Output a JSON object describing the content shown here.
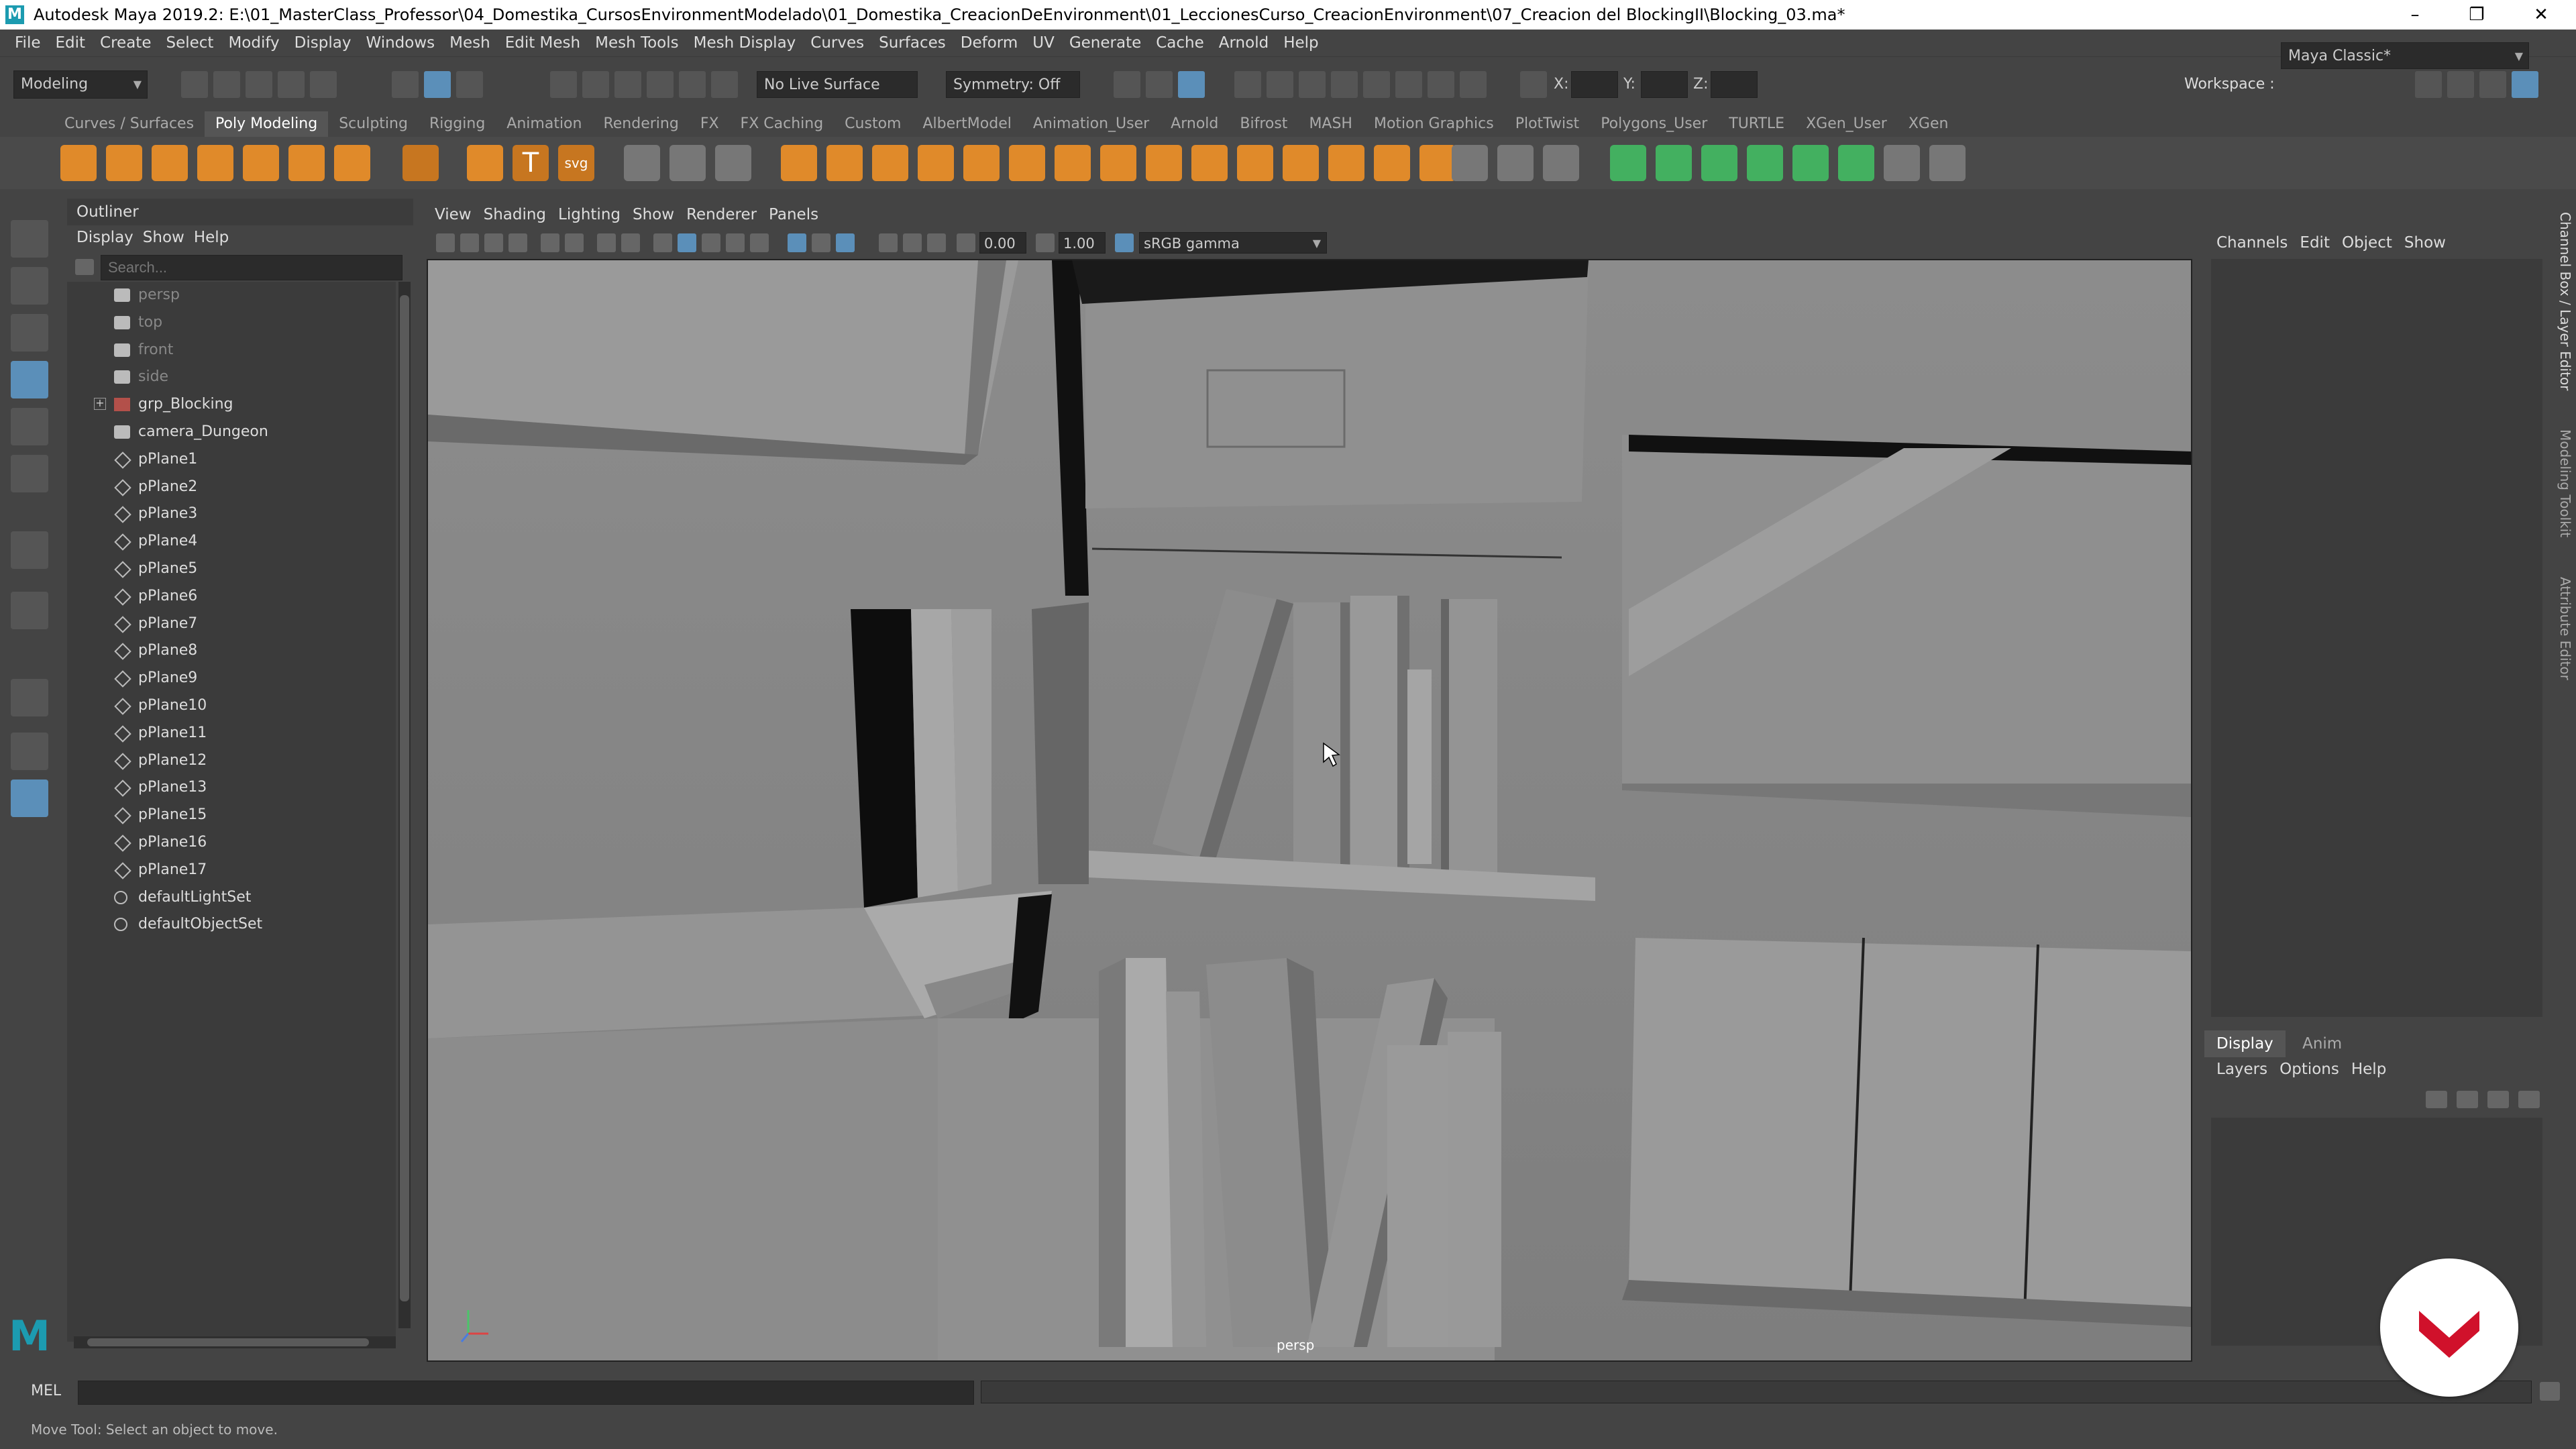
{
  "window": {
    "title": "Autodesk Maya 2019.2: E:\\01_MasterClass_Professor\\04_Domestika_CursosEnvironmentModelado\\01_Domestika_CreacionDeEnvironment\\01_LeccionesCurso_CreacionEnvironment\\07_Creacion del BlockingII\\Blocking_03.ma*",
    "logo": "M",
    "minimize": "–",
    "restore": "❐",
    "close": "✕"
  },
  "menubar": [
    "File",
    "Edit",
    "Create",
    "Select",
    "Modify",
    "Display",
    "Windows",
    "Mesh",
    "Edit Mesh",
    "Mesh Tools",
    "Mesh Display",
    "Curves",
    "Surfaces",
    "Deform",
    "UV",
    "Generate",
    "Cache",
    "Arnold",
    "Help"
  ],
  "statusline": {
    "menuset": "Modeling",
    "live_surface": "No Live Surface",
    "symmetry": "Symmetry: Off",
    "x_label": "X:",
    "y_label": "Y:",
    "z_label": "Z:",
    "workspace_label": "Workspace :",
    "workspace_value": "Maya Classic*"
  },
  "shelf_tabs": [
    "Curves / Surfaces",
    "Poly Modeling",
    "Sculpting",
    "Rigging",
    "Animation",
    "Rendering",
    "FX",
    "FX Caching",
    "Custom",
    "AlbertModel",
    "Animation_User",
    "Arnold",
    "Bifrost",
    "MASH",
    "Motion Graphics",
    "PlotTwist",
    "Polygons_User",
    "TURTLE",
    "XGen_User",
    "XGen"
  ],
  "shelf_active": "Poly Modeling",
  "shelf_text_tool": "T",
  "shelf_svg_tool": "svg",
  "outliner": {
    "title": "Outliner",
    "menu": [
      "Display",
      "Show",
      "Help"
    ],
    "search_placeholder": "Search...",
    "items": [
      {
        "label": "persp",
        "type": "camera",
        "dim": true
      },
      {
        "label": "top",
        "type": "camera",
        "dim": true
      },
      {
        "label": "front",
        "type": "camera",
        "dim": true
      },
      {
        "label": "side",
        "type": "camera",
        "dim": true
      },
      {
        "label": "grp_Blocking",
        "type": "group",
        "dim": false
      },
      {
        "label": "camera_Dungeon",
        "type": "camera",
        "dim": false
      },
      {
        "label": "pPlane1",
        "type": "mesh",
        "dim": false
      },
      {
        "label": "pPlane2",
        "type": "mesh",
        "dim": false
      },
      {
        "label": "pPlane3",
        "type": "mesh",
        "dim": false
      },
      {
        "label": "pPlane4",
        "type": "mesh",
        "dim": false
      },
      {
        "label": "pPlane5",
        "type": "mesh",
        "dim": false
      },
      {
        "label": "pPlane6",
        "type": "mesh",
        "dim": false
      },
      {
        "label": "pPlane7",
        "type": "mesh",
        "dim": false
      },
      {
        "label": "pPlane8",
        "type": "mesh",
        "dim": false
      },
      {
        "label": "pPlane9",
        "type": "mesh",
        "dim": false
      },
      {
        "label": "pPlane10",
        "type": "mesh",
        "dim": false
      },
      {
        "label": "pPlane11",
        "type": "mesh",
        "dim": false
      },
      {
        "label": "pPlane12",
        "type": "mesh",
        "dim": false
      },
      {
        "label": "pPlane13",
        "type": "mesh",
        "dim": false
      },
      {
        "label": "pPlane15",
        "type": "mesh",
        "dim": false
      },
      {
        "label": "pPlane16",
        "type": "mesh",
        "dim": false
      },
      {
        "label": "pPlane17",
        "type": "mesh",
        "dim": false
      },
      {
        "label": "defaultLightSet",
        "type": "set",
        "dim": false
      },
      {
        "label": "defaultObjectSet",
        "type": "set",
        "dim": false
      }
    ]
  },
  "viewport": {
    "menu": [
      "View",
      "Shading",
      "Lighting",
      "Show",
      "Renderer",
      "Panels"
    ],
    "exposure": "0.00",
    "gamma": "1.00",
    "color_space": "sRGB gamma",
    "camera_label": "persp"
  },
  "channelbox": {
    "menu": [
      "Channels",
      "Edit",
      "Object",
      "Show"
    ]
  },
  "side_tabs": [
    "Channel Box / Layer Editor",
    "Modeling Toolkit",
    "Attribute Editor"
  ],
  "layer_editor": {
    "tabs": [
      "Display",
      "Anim"
    ],
    "active_tab": "Display",
    "menu": [
      "Layers",
      "Options",
      "Help"
    ]
  },
  "cmdline": {
    "label": "MEL"
  },
  "helpline": {
    "text": "Move Tool: Select an object to move."
  },
  "colors": {
    "accent": "#5b8fb9",
    "shelf_orange": "#e08a2a",
    "brand_red": "#d0112b"
  }
}
